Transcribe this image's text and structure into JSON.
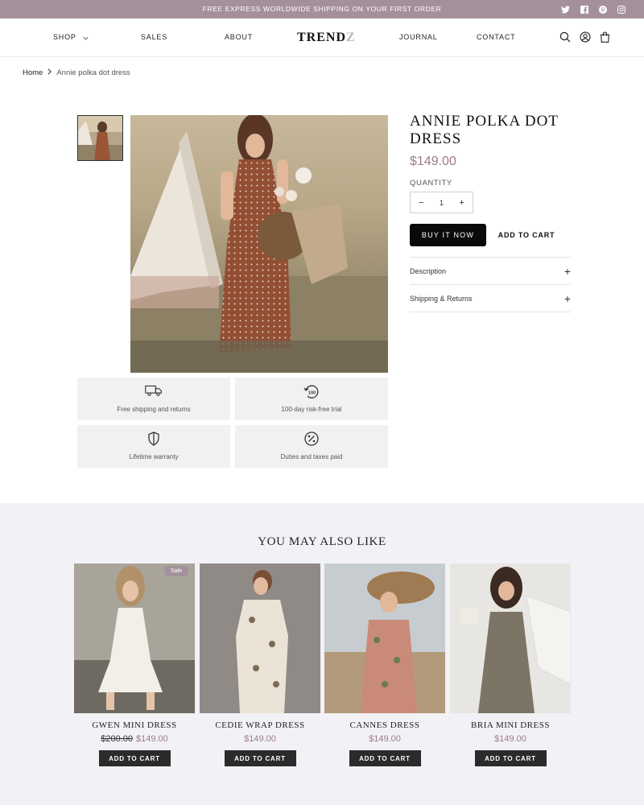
{
  "announcement": {
    "text": "FREE EXPRESS WORLDWIDE SHIPPING ON YOUR FIRST ORDER"
  },
  "social": [
    "twitter-icon",
    "facebook-icon",
    "pinterest-icon",
    "instagram-icon"
  ],
  "nav": {
    "shop": "SHOP",
    "sales": "SALES",
    "about": "ABOUT",
    "journal": "JOURNAL",
    "contact": "CONTACT"
  },
  "logo": {
    "main": "TREND",
    "accent": "Z"
  },
  "breadcrumb": {
    "home": "Home",
    "current": "Annie polka dot dress"
  },
  "product": {
    "title": "ANNIE POLKA DOT DRESS",
    "price": "$149.00",
    "quantity_label": "QUANTITY",
    "quantity": "1",
    "buy_now": "BUY IT NOW",
    "add_to_cart": "ADD TO CART",
    "accordion": [
      "Description",
      "Shipping & Returns"
    ]
  },
  "features": [
    {
      "label": "Free shipping and returns",
      "icon": "truck-icon"
    },
    {
      "label": "100-day risk-free trial",
      "icon": "trial-icon"
    },
    {
      "label": "Lifetime warranty",
      "icon": "shield-icon"
    },
    {
      "label": "Duties and taxes paid",
      "icon": "percent-icon"
    }
  ],
  "related": {
    "heading": "YOU MAY ALSO LIKE",
    "sale_badge": "Sale",
    "cart_label": "ADD TO CART",
    "items": [
      {
        "name": "GWEN MINI DRESS",
        "old_price": "$200.00",
        "price": "$149.00"
      },
      {
        "name": "CEDIE WRAP DRESS",
        "price": "$149.00"
      },
      {
        "name": "CANNES DRESS",
        "price": "$149.00"
      },
      {
        "name": "BRIA MINI DRESS",
        "price": "$149.00"
      }
    ]
  },
  "colors": {
    "accent": "#a4909c",
    "price": "#9c7c8d",
    "related_bg": "#f2f1f5",
    "tile_bg": "#f2f1ef"
  }
}
